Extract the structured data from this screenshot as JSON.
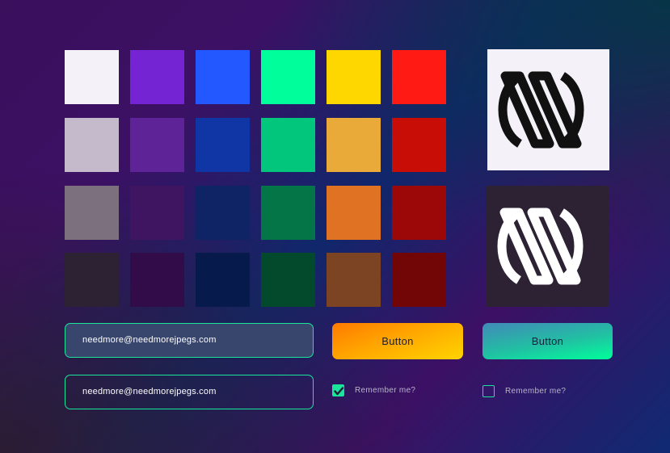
{
  "palette": {
    "rows": [
      [
        "#f4f2f8",
        "#7524d4",
        "#2357ff",
        "#00ff9b",
        "#ffd700",
        "#ff1a14"
      ],
      [
        "#c5bacb",
        "#5d2397",
        "#1036a6",
        "#03c67d",
        "#eaaa3a",
        "#c80d06"
      ],
      [
        "#7c707e",
        "#3f1460",
        "#0e2464",
        "#037546",
        "#e07224",
        "#9c0707"
      ],
      [
        "#2c2233",
        "#310c48",
        "#061a4b",
        "#024a2b",
        "#7c4422",
        "#720505"
      ]
    ]
  },
  "logos": [
    {
      "variant": "light",
      "background": "#f4f2f8",
      "mark_color": "#111111"
    },
    {
      "variant": "dark",
      "background": "#2c2233",
      "mark_color": "#ffffff"
    }
  ],
  "form": {
    "email_filled": "needmore@needmorejpegs.com",
    "email_outlined": "needmore@needmorejpegs.com",
    "button_primary": "Button",
    "button_secondary": "Button",
    "remember_checked_label": "Remember me?",
    "remember_unchecked_label": "Remember me?"
  },
  "colors": {
    "accent": "#19e69b"
  }
}
